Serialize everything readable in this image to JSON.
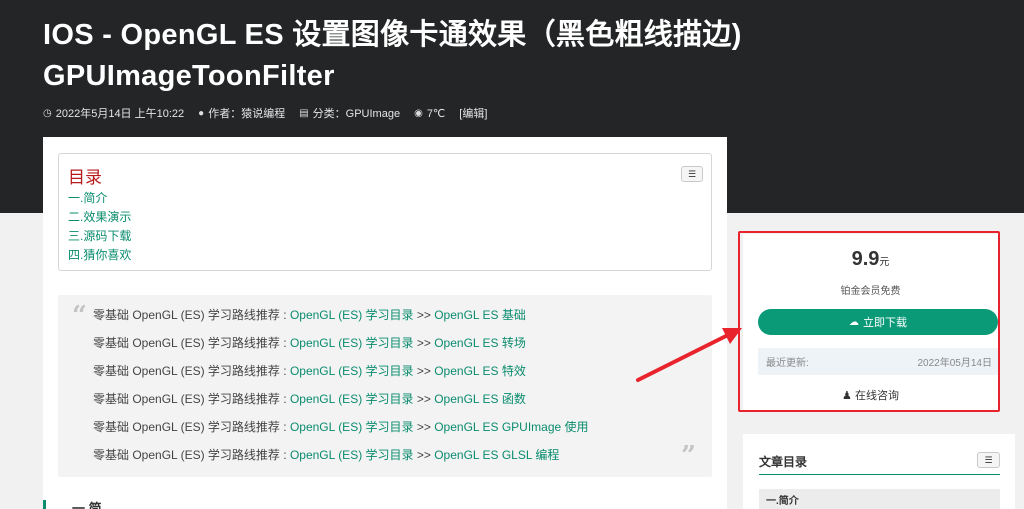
{
  "header": {
    "title": "IOS  -  OpenGL ES 设置图像卡通效果（黑色粗线描边) GPUImageToonFilter",
    "date": "2022年5月14日 上午10:22",
    "author": "作者：猿说编程",
    "category": "分类：GPUImage",
    "views": "7℃",
    "edit": "[编辑]"
  },
  "toc": {
    "title": "目录",
    "items": [
      "一.简介",
      "二.效果演示",
      "三.源码下载",
      "四.猜你喜欢"
    ]
  },
  "quote": {
    "prefix": "零基础 OpenGL (ES) 学习路线推荐 : ",
    "catalog_link": "OpenGL (ES) 学习目录",
    "sep": " >> ",
    "links": [
      "OpenGL ES 基础",
      "OpenGL ES 转场",
      "OpenGL ES 特效",
      "OpenGL ES 函数",
      "OpenGL ES GPUImage 使用",
      "OpenGL ES GLSL 编程"
    ]
  },
  "section_peek": "一.简介",
  "download_card": {
    "price": "9.9",
    "unit": "元",
    "member": "铂金会员免费",
    "button": "立即下载",
    "update_label": "最近更新:",
    "update_date": "2022年05月14日",
    "consult": "在线咨询"
  },
  "side_toc": {
    "title": "文章目录",
    "first_item": "一.简介"
  },
  "colors": {
    "accent": "#0a9a78",
    "header_bg": "#232526",
    "highlight": "#e8232d",
    "toc_title": "#b71c1c"
  }
}
